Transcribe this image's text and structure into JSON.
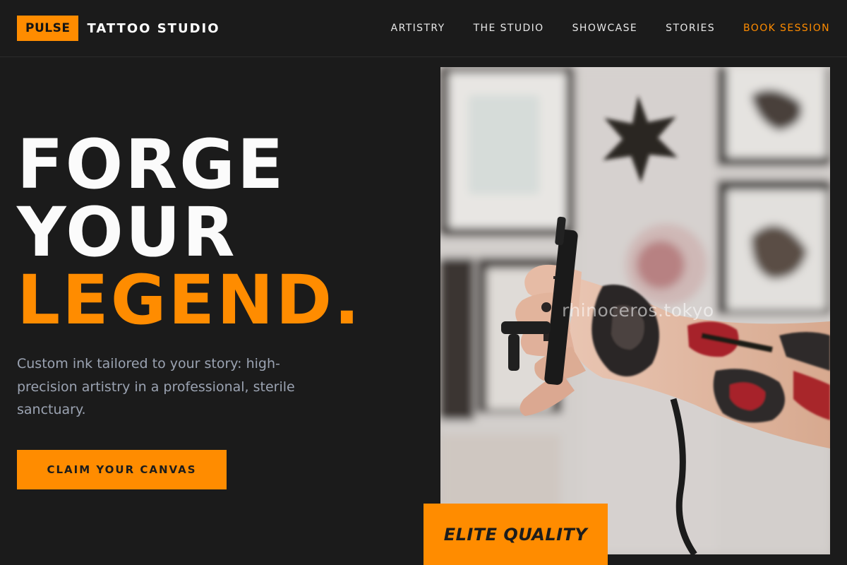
{
  "brand": {
    "badge": "PULSE",
    "name": "TATTOO STUDIO"
  },
  "nav": {
    "items": [
      {
        "label": "ARTISTRY"
      },
      {
        "label": "THE STUDIO"
      },
      {
        "label": "SHOWCASE"
      },
      {
        "label": "STORIES"
      },
      {
        "label": "BOOK SESSION"
      }
    ]
  },
  "hero": {
    "title_line1": "FORGE",
    "title_line2": "YOUR",
    "title_line3": "LEGEND.",
    "subtitle": "Custom ink tailored to your story: high-precision artistry in a professional, sterile sanctuary.",
    "cta_label": "CLAIM YOUR CANVAS"
  },
  "photo": {
    "watermark": "rhinoceros.tokyo"
  },
  "badge": {
    "label": "ELITE QUALITY"
  },
  "colors": {
    "background": "#1b1b1b",
    "accent": "#ff8c00",
    "text_primary": "#fbfbfb",
    "text_muted": "#9ba3b2"
  },
  "icons": {
    "photo_subject": "tattooed-arm-with-machine"
  }
}
